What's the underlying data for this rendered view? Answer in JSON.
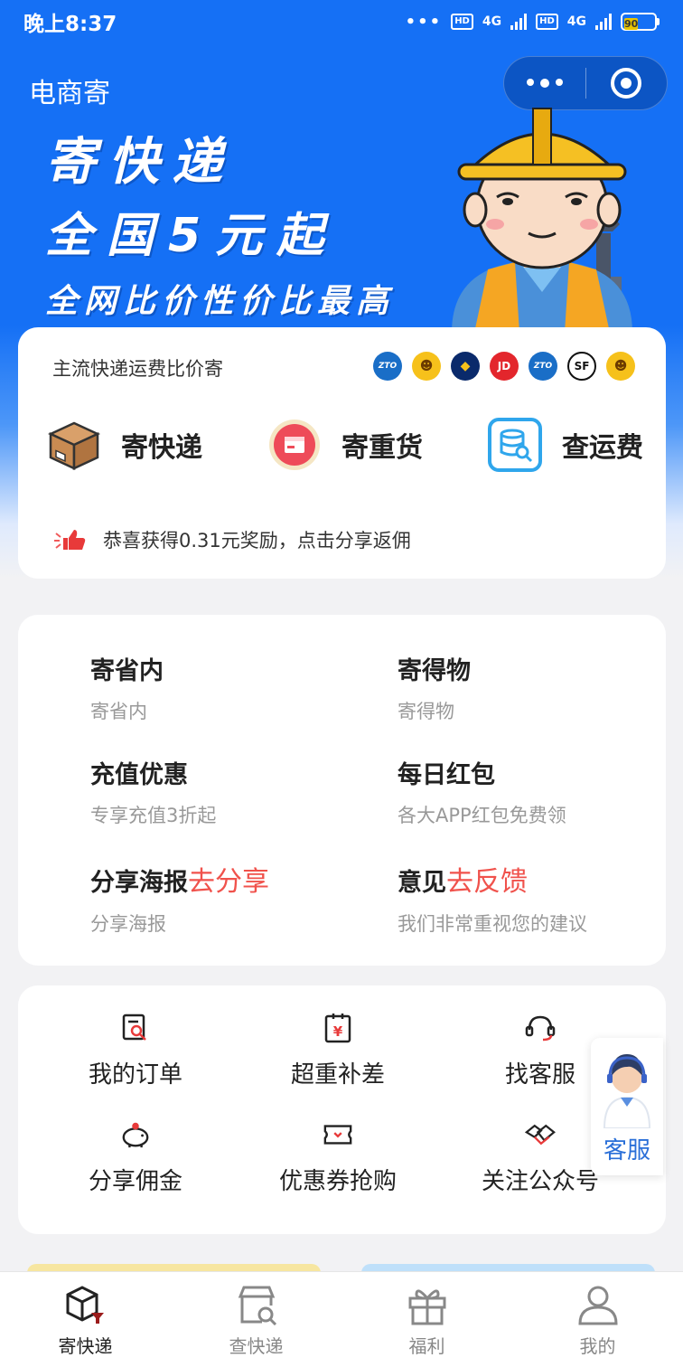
{
  "status_bar": {
    "time": "晚上8:37",
    "net1": "4G",
    "net2": "4G",
    "hd": "HD",
    "battery": "90"
  },
  "header": {
    "title": "电商寄"
  },
  "banner": {
    "line1": "寄快递",
    "line2": "全国5元起",
    "line3": "全网比价性价比最高"
  },
  "compare": {
    "text": "主流快递运费比价寄",
    "brands": [
      "ZTO",
      "韵",
      "圆",
      "JD",
      "ZTO",
      "SF",
      "韵"
    ]
  },
  "actions": [
    {
      "label": "寄快递",
      "icon": "parcel-box-icon"
    },
    {
      "label": "寄重货",
      "icon": "heavy-cargo-icon"
    },
    {
      "label": "查运费",
      "icon": "freight-search-icon"
    }
  ],
  "reward": {
    "text": "恭喜获得0.31元奖励，点击分享返佣",
    "icon": "thumbs-up-icon"
  },
  "features": [
    {
      "title": "寄省内",
      "highlight": "",
      "sub": "寄省内"
    },
    {
      "title": "寄得物",
      "highlight": "",
      "sub": "寄得物"
    },
    {
      "title": "充值优惠",
      "highlight": "",
      "sub": "专享充值3折起"
    },
    {
      "title": "每日红包",
      "highlight": "",
      "sub": "各大APP红包免费领"
    },
    {
      "title": "分享海报",
      "highlight": "去分享",
      "sub": "分享海报"
    },
    {
      "title": "意见",
      "highlight": "去反馈",
      "sub": "我们非常重视您的建议"
    }
  ],
  "tools": [
    {
      "label": "我的订单",
      "icon": "order-search-icon"
    },
    {
      "label": "超重补差",
      "icon": "yen-clipboard-icon"
    },
    {
      "label": "找客服",
      "icon": "headset-icon"
    },
    {
      "label": "分享佣金",
      "icon": "piggy-bank-icon"
    },
    {
      "label": "优惠券抢购",
      "icon": "coupon-icon"
    },
    {
      "label": "关注公众号",
      "icon": "handshake-icon"
    }
  ],
  "service": {
    "label": "客服"
  },
  "tabbar": [
    {
      "label": "寄快递",
      "icon": "parcel-tab-icon",
      "active": true
    },
    {
      "label": "查快递",
      "icon": "store-search-tab-icon",
      "active": false
    },
    {
      "label": "福利",
      "icon": "gift-tab-icon",
      "active": false
    },
    {
      "label": "我的",
      "icon": "profile-tab-icon",
      "active": false
    }
  ],
  "colors": {
    "brand_blue": "#1570f5",
    "accent_red": "#f0524c",
    "service_blue": "#2a6fd8"
  }
}
